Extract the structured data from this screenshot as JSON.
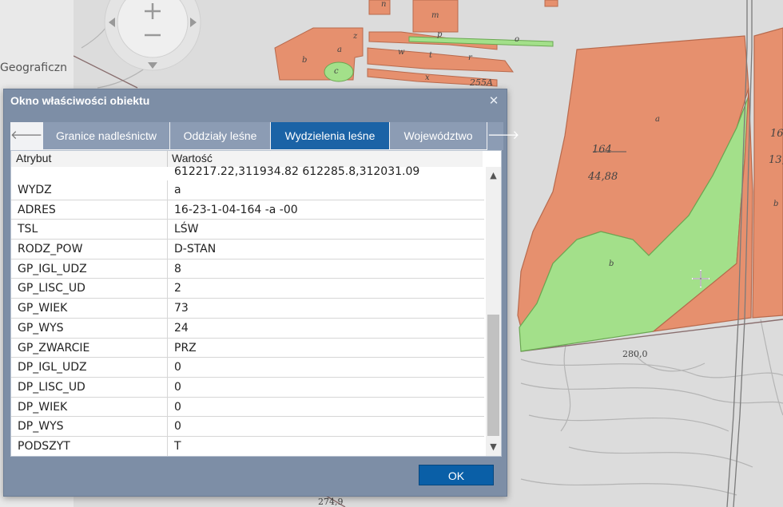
{
  "map": {
    "side_label": "Geograficzn",
    "labels": {
      "n": "n",
      "m": "m",
      "z": "z",
      "p": "p",
      "o": "o",
      "b_left": "b",
      "a_left": "a",
      "c": "c",
      "w": "w",
      "t": "t",
      "r": "r",
      "x": "x",
      "parcel_255a": "255A",
      "a_big": "a",
      "b_green": "b",
      "b_right": "b",
      "num_164": "164",
      "num_44_88": "44,88",
      "num_16": "16",
      "num_13": "13,",
      "contour_280": "280,0",
      "contour_274": "274,9"
    }
  },
  "dialog": {
    "title": "Okno właściwości obiektu",
    "tabs": [
      "Granice nadleśnictw",
      "Oddziały leśne",
      "Wydzielenia leśne",
      "Województwo"
    ],
    "active_tab": "Wydzielenia leśne",
    "columns": {
      "attribute": "Atrybut",
      "value": "Wartość"
    },
    "partial_value": "612217.22,311934.82 612285.8,312031.09",
    "rows": [
      {
        "k": "WYDZ",
        "v": "a"
      },
      {
        "k": "ADRES",
        "v": "16-23-1-04-164 -a -00"
      },
      {
        "k": "TSL",
        "v": "LŚW"
      },
      {
        "k": "RODZ_POW",
        "v": "D-STAN"
      },
      {
        "k": "GP_IGL_UDZ",
        "v": "8"
      },
      {
        "k": "GP_LISC_UD",
        "v": "2"
      },
      {
        "k": "GP_WIEK",
        "v": "73"
      },
      {
        "k": "GP_WYS",
        "v": "24"
      },
      {
        "k": "GP_ZWARCIE",
        "v": "PRZ"
      },
      {
        "k": "DP_IGL_UDZ",
        "v": "0"
      },
      {
        "k": "DP_LISC_UD",
        "v": "0"
      },
      {
        "k": "DP_WIEK",
        "v": "0"
      },
      {
        "k": "DP_WYS",
        "v": "0"
      },
      {
        "k": "PODSZYT",
        "v": "T"
      }
    ],
    "ok_label": "OK"
  },
  "colors": {
    "dialog_bg": "#7d8ea6",
    "tab_active": "#1b63a6",
    "tab_inactive": "#8c9cb4",
    "ok_button": "#0a5fa7",
    "parcel_orange": "#e6906e",
    "forest_green": "#a3e08a"
  },
  "icons": {
    "close": "close-icon",
    "tab_prev": "arrow-left-icon",
    "tab_next": "arrow-right-icon",
    "scroll_up": "chevron-up-icon",
    "scroll_down": "chevron-down-icon",
    "zoom_in": "plus-icon",
    "zoom_out": "minus-icon",
    "crosshair": "crosshair-icon"
  }
}
